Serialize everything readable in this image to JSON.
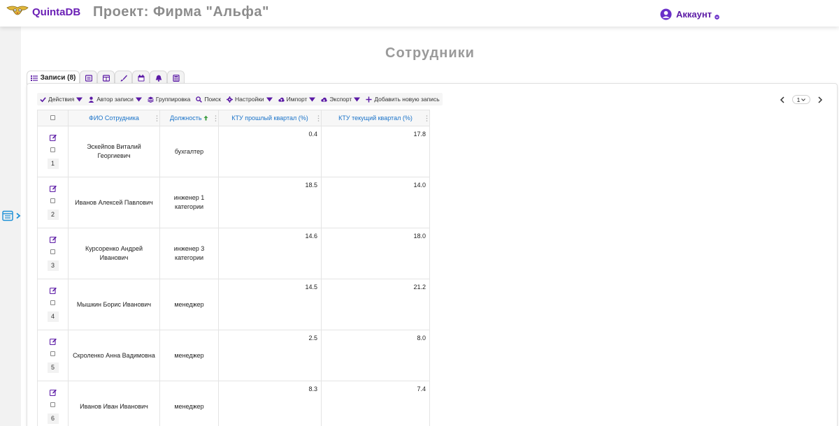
{
  "header": {
    "brand": "QuintaDB",
    "project_title": "Проект: Фирма \"Альфа\"",
    "account_label": "Аккаунт"
  },
  "page": {
    "title": "Сотрудники"
  },
  "tabs": [
    {
      "label": "Записи (8)",
      "icon": "list-icon",
      "active": true
    },
    {
      "label": "",
      "icon": "table-view-icon"
    },
    {
      "label": "",
      "icon": "columns-icon"
    },
    {
      "label": "",
      "icon": "brush-icon"
    },
    {
      "label": "",
      "icon": "calendar-icon"
    },
    {
      "label": "",
      "icon": "bell-icon"
    },
    {
      "label": "",
      "icon": "calculator-icon"
    }
  ],
  "toolbar": {
    "actions": "Действия",
    "author": "Автор записи",
    "grouping": "Группировка",
    "search": "Поиск",
    "settings": "Настройки",
    "import": "Импорт",
    "export": "Экспорт",
    "add": "Добавить новую запись"
  },
  "pager": {
    "current_page": "1"
  },
  "table": {
    "columns": {
      "name": "ФИО Сотрудника",
      "position": "Должность",
      "ktu_prev": "КТУ прошлый квартал (%)",
      "ktu_curr": "КТУ текущий квартал (%)"
    },
    "rows": [
      {
        "n": "1",
        "name": "Эскейпов Виталий Георгиевич",
        "position": "бухгалтер",
        "prev": "0.4",
        "curr": "17.8"
      },
      {
        "n": "2",
        "name": "Иванов Алексей Павлович",
        "position": "инженер 1 категории",
        "prev": "18.5",
        "curr": "14.0"
      },
      {
        "n": "3",
        "name": "Курсоренко Андрей Иванович",
        "position": "инженер 3 категории",
        "prev": "14.6",
        "curr": "18.0"
      },
      {
        "n": "4",
        "name": "Мышкин Борис Иванович",
        "position": "менеджер",
        "prev": "14.5",
        "curr": "21.2"
      },
      {
        "n": "5",
        "name": "Скроленко Анна Вадимовна",
        "position": "менеджер",
        "prev": "2.5",
        "curr": "8.0"
      },
      {
        "n": "6",
        "name": "Иванов Иван Иванович",
        "position": "менеджер",
        "prev": "8.3",
        "curr": "7.4"
      }
    ]
  },
  "colors": {
    "brand": "#6a1fb5",
    "link": "#1a73c9",
    "sort_arrow": "#43a047",
    "rail_icon": "#1a8fd6"
  }
}
